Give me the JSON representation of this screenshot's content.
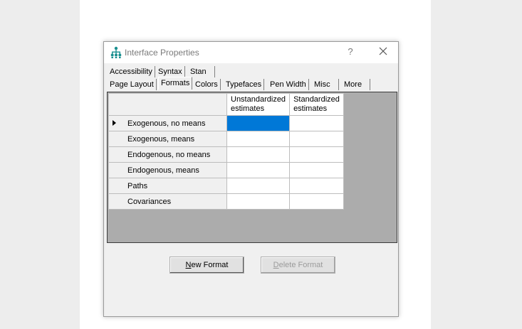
{
  "window": {
    "title": "Interface Properties",
    "help": "?"
  },
  "tabs_row1": [
    {
      "label": "Accessibility"
    },
    {
      "label": "Syntax"
    },
    {
      "label": "Stan"
    }
  ],
  "tabs_row2": [
    {
      "label": "Page Layout"
    },
    {
      "label": "Formats",
      "active": true
    },
    {
      "label": "Colors"
    },
    {
      "label": "Typefaces"
    },
    {
      "label": "Pen Width"
    },
    {
      "label": "Misc"
    },
    {
      "label": "More"
    }
  ],
  "grid": {
    "columns": [
      "Unstandardized estimates",
      "Standardized estimates"
    ],
    "rows": [
      {
        "label": "Exogenous, no means",
        "current": true
      },
      {
        "label": "Exogenous, means"
      },
      {
        "label": "Endogenous, no means"
      },
      {
        "label": "Endogenous, means"
      },
      {
        "label": "Paths"
      },
      {
        "label": "Covariances"
      }
    ],
    "selected_color": "#0078d7"
  },
  "buttons": {
    "new_format": {
      "label": "New Format",
      "mnemonic": "N"
    },
    "delete_format": {
      "label": "Delete Format",
      "mnemonic": "D",
      "disabled": true
    }
  },
  "icons": {
    "app": "network-tree-icon",
    "close": "close-icon",
    "row_marker": "row-pointer-icon"
  }
}
